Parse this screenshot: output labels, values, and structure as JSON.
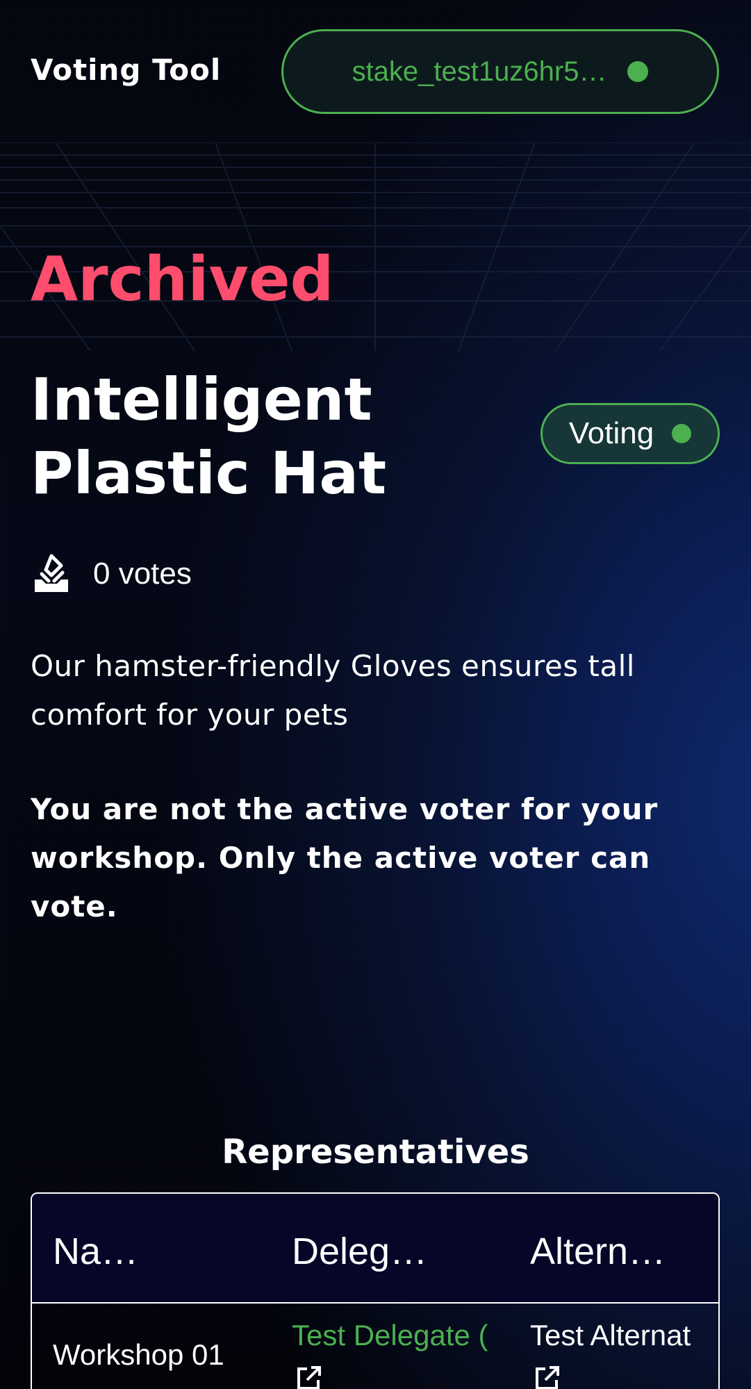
{
  "header": {
    "app_title": "Voting Tool",
    "wallet_address": "stake_test1uz6hr5…"
  },
  "proposal": {
    "status": "Archived",
    "title": "Intelligent Plastic Hat",
    "stage_badge": "Voting",
    "votes": "0 votes",
    "description": "Our hamster-friendly Gloves ensures tall comfort for your pets",
    "notice": "You are not the active voter for your workshop. Only the active voter can vote."
  },
  "representatives": {
    "heading": "Representatives",
    "columns": [
      "Na…",
      "Deleg…",
      "Altern…"
    ],
    "rows": [
      {
        "name": "Workshop 01",
        "delegate": "Test Delegate (",
        "alternate": "Test Alternat"
      }
    ]
  },
  "colors": {
    "accent_green": "#4caf50",
    "archived_red": "#ff4d6d",
    "background": "#050816"
  },
  "icons": [
    "vote-icon",
    "external-link-icon"
  ]
}
